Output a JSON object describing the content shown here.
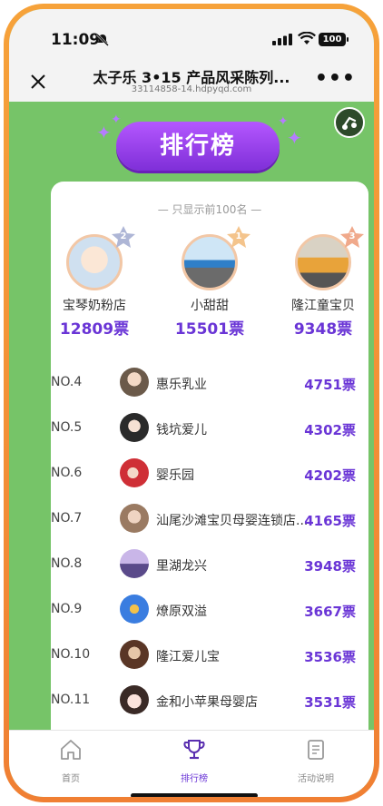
{
  "status": {
    "time": "11:09",
    "battery": "100"
  },
  "nav": {
    "title": "太子乐 3•15 产品风采陈列...",
    "url": "33114858-14.hdpyqd.com"
  },
  "banner": {
    "label": "排行榜"
  },
  "notice": "— 只显示前100名 —",
  "podium": [
    {
      "place": "2",
      "name": "宝琴奶粉店",
      "votes": "12809票",
      "color": "#aeb6d6"
    },
    {
      "place": "1",
      "name": "小甜甜",
      "votes": "15501票",
      "color": "#f4c48c"
    },
    {
      "place": "3",
      "name": "隆江童宝贝",
      "votes": "9348票",
      "color": "#f0a98b"
    }
  ],
  "rows": [
    {
      "rank": "NO.4",
      "name": "惠乐乳业",
      "votes": "4751票",
      "avatar_color": "#c79a78"
    },
    {
      "rank": "NO.5",
      "name": "钱坑爱儿",
      "votes": "4302票",
      "avatar_color": "#3a3a3a"
    },
    {
      "rank": "NO.6",
      "name": "婴乐园",
      "votes": "4202票",
      "avatar_color": "#d23a3a"
    },
    {
      "rank": "NO.7",
      "name": "汕尾沙滩宝贝母婴连锁店...",
      "votes": "4165票",
      "avatar_color": "#b88a6a"
    },
    {
      "rank": "NO.8",
      "name": "里湖龙兴",
      "votes": "3948票",
      "avatar_color": "#8a7fc2"
    },
    {
      "rank": "NO.9",
      "name": "燎原双溢",
      "votes": "3667票",
      "avatar_color": "#3a7de0"
    },
    {
      "rank": "NO.10",
      "name": "隆江爱儿宝",
      "votes": "3536票",
      "avatar_color": "#7a4a3a"
    },
    {
      "rank": "NO.11",
      "name": "金和小苹果母婴店",
      "votes": "3531票",
      "avatar_color": "#f0c8c0"
    }
  ],
  "tabs": [
    {
      "label": "首页",
      "icon": "home-icon",
      "active": false
    },
    {
      "label": "排行榜",
      "icon": "trophy-icon",
      "active": true
    },
    {
      "label": "活动说明",
      "icon": "document-icon",
      "active": false
    }
  ],
  "colors": {
    "accent": "#6a35d6",
    "background": "#76c468",
    "frame": "#f28d35"
  }
}
